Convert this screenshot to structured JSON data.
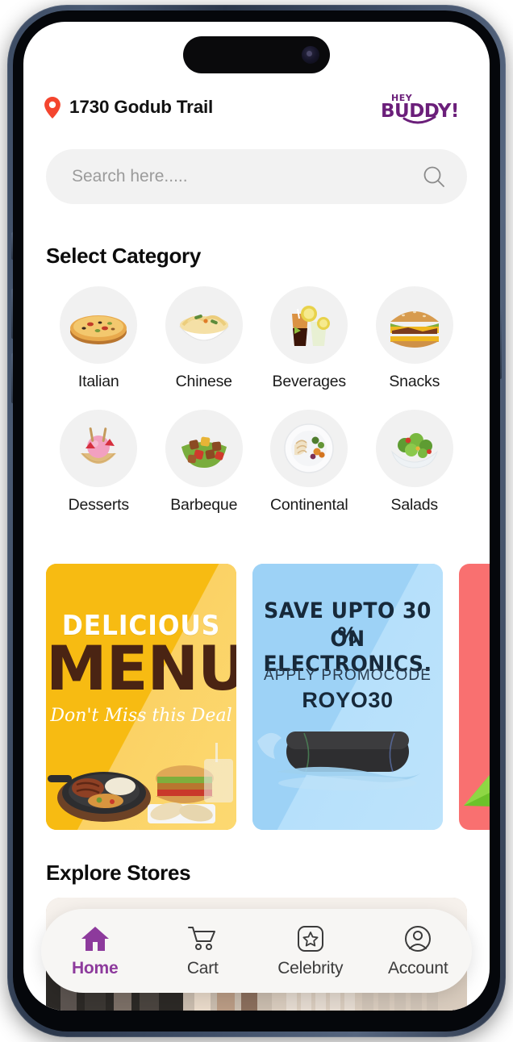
{
  "device": {
    "frame_color": "#3c4b63",
    "notch_name": "dynamic-island"
  },
  "header": {
    "address": "1730 Godub Trail",
    "pin_icon": "location-pin-icon",
    "logo_line1": "HEY",
    "logo_line2": "BUDDY!",
    "logo_color": "#6b1f7a"
  },
  "search": {
    "placeholder": "Search here.....",
    "value": "",
    "icon": "search-icon"
  },
  "categories": {
    "title": "Select Category",
    "items": [
      {
        "label": "Italian",
        "icon": "pizza-icon"
      },
      {
        "label": "Chinese",
        "icon": "noodle-bowl-icon"
      },
      {
        "label": "Beverages",
        "icon": "drinks-icon"
      },
      {
        "label": "Snacks",
        "icon": "burger-icon"
      },
      {
        "label": "Desserts",
        "icon": "ice-cream-icon"
      },
      {
        "label": "Barbeque",
        "icon": "barbeque-icon"
      },
      {
        "label": "Continental",
        "icon": "plated-meal-icon"
      },
      {
        "label": "Salads",
        "icon": "salad-bowl-icon"
      }
    ]
  },
  "promos": [
    {
      "id": "delicious-menu",
      "bg": "#f7bb12",
      "line1": "DELICIOUS",
      "line2": "MENU",
      "line3": "Don't Miss this Deal"
    },
    {
      "id": "electronics-offer",
      "bg": "#9dd2f6",
      "line1": "SAVE UPTO 30 %",
      "line2": "ON ELECTRONICS.",
      "apply_label": "APPLY PROMOCODE",
      "promocode": "ROYO30"
    },
    {
      "id": "pink-offer",
      "bg": "#f97070",
      "line1": "",
      "line2": ""
    }
  ],
  "stores": {
    "title": "Explore Stores"
  },
  "bottom_nav": {
    "active_color": "#8d3a9c",
    "items": [
      {
        "label": "Home",
        "icon": "home-icon",
        "active": true
      },
      {
        "label": "Cart",
        "icon": "cart-icon",
        "active": false
      },
      {
        "label": "Celebrity",
        "icon": "star-box-icon",
        "active": false
      },
      {
        "label": "Account",
        "icon": "user-circle-icon",
        "active": false
      }
    ]
  }
}
